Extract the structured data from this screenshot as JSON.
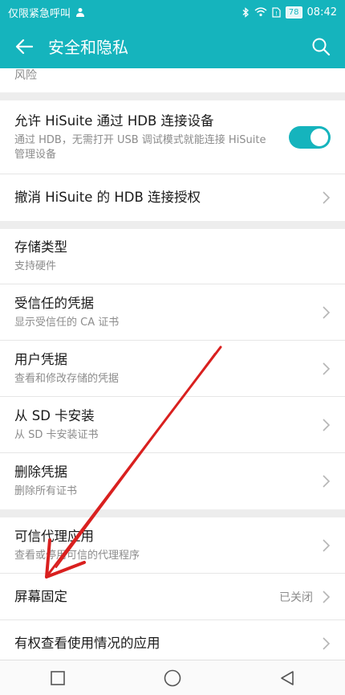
{
  "status": {
    "carrier_text": "仅限紧急呼叫",
    "battery": "78",
    "time": "08:42"
  },
  "appbar": {
    "title": "安全和隐私"
  },
  "partial_row": {
    "label": "风险"
  },
  "group1": [
    {
      "title": "允许 HiSuite 通过 HDB 连接设备",
      "subtitle": "通过 HDB，无需打开 USB 调试模式就能连接 HiSuite 管理设备",
      "toggle_on": true
    },
    {
      "title": "撤消 HiSuite 的 HDB 连接授权"
    }
  ],
  "group2": [
    {
      "title": "存储类型",
      "subtitle": "支持硬件"
    },
    {
      "title": "受信任的凭据",
      "subtitle": "显示受信任的 CA 证书"
    },
    {
      "title": "用户凭据",
      "subtitle": "查看和修改存储的凭据"
    },
    {
      "title": "从 SD 卡安装",
      "subtitle": "从 SD 卡安装证书"
    },
    {
      "title": "删除凭据",
      "subtitle": "删除所有证书"
    }
  ],
  "group3": [
    {
      "title": "可信代理应用",
      "subtitle": "查看或停用可信的代理程序"
    },
    {
      "title": "屏幕固定",
      "value": "已关闭"
    },
    {
      "title": "有权查看使用情况的应用"
    }
  ],
  "colors": {
    "accent": "#15b4bd",
    "annotation_arrow": "#d9201f"
  },
  "icons": {
    "back": "back-arrow-icon",
    "search": "search-icon",
    "chevron": "chevron-right-icon"
  }
}
